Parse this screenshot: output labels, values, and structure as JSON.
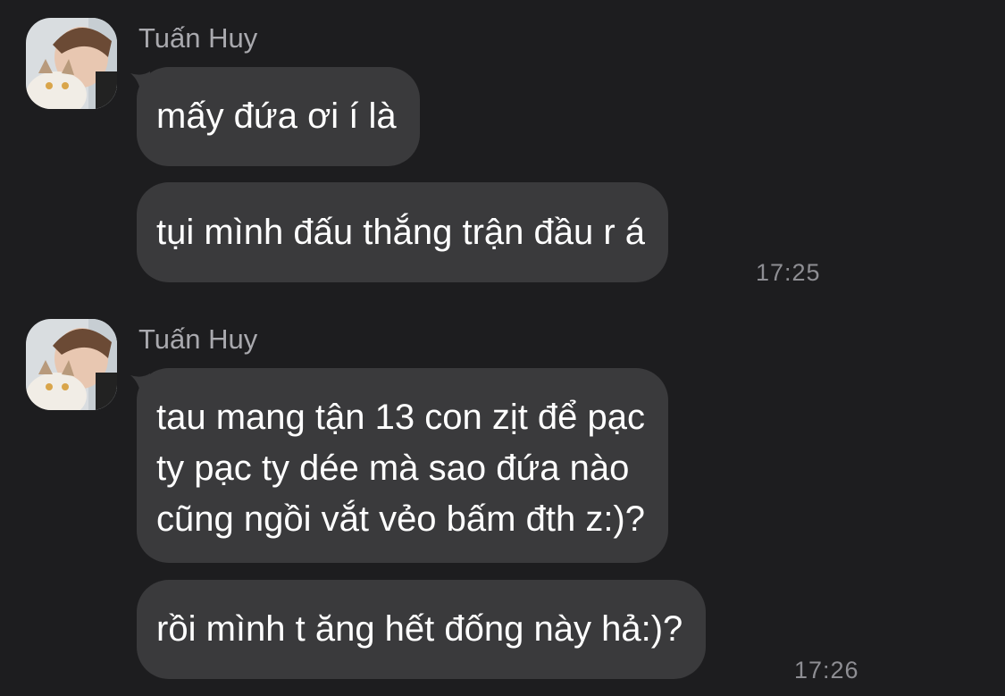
{
  "chat": {
    "groups": [
      {
        "sender": "Tuấn Huy",
        "avatar_icon": "user-avatar-with-cat",
        "messages": [
          {
            "lines": [
              "mấy đứa ơi í là"
            ]
          },
          {
            "lines": [
              "tụi mình đấu thắng trận đầu r á"
            ]
          }
        ],
        "time": "17:25"
      },
      {
        "sender": "Tuấn Huy",
        "avatar_icon": "user-avatar-with-cat",
        "messages": [
          {
            "lines": [
              "tau mang tận 13 con zịt để pạc",
              "ty pạc ty dée mà sao đứa nào",
              "cũng ngồi vắt vẻo bấm đth z:)?"
            ]
          },
          {
            "lines": [
              "rồi mình t ăng hết đống này hả:)?"
            ]
          }
        ],
        "time": "17:26"
      }
    ]
  },
  "colors": {
    "background": "#1d1d1f",
    "bubble": "#3a3a3c",
    "sender_name": "#a9a9ae",
    "timestamp": "#8e8e93",
    "message_text": "#ffffff"
  }
}
